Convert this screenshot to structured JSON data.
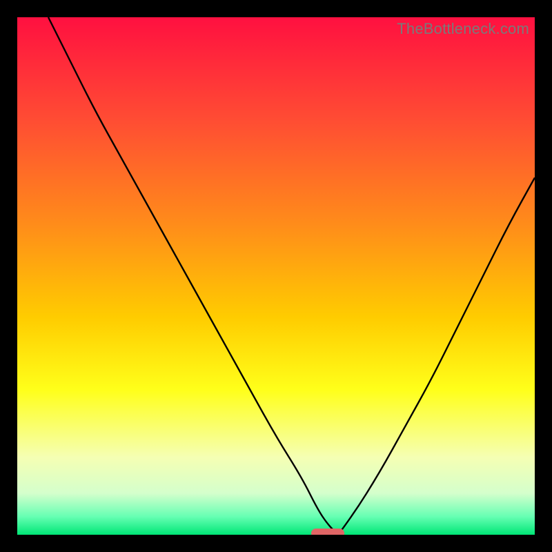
{
  "watermark": "TheBottleneck.com",
  "chart_data": {
    "type": "line",
    "title": "",
    "xlabel": "",
    "ylabel": "",
    "xlim": [
      0,
      100
    ],
    "ylim": [
      0,
      100
    ],
    "grid": false,
    "legend": false,
    "series": [
      {
        "name": "left-branch",
        "x": [
          6,
          10,
          15,
          20,
          25,
          30,
          35,
          40,
          45,
          50,
          55,
          58,
          60,
          62
        ],
        "y": [
          100,
          92,
          82,
          73,
          64,
          55,
          46,
          37,
          28,
          19,
          11,
          5,
          2,
          0
        ]
      },
      {
        "name": "right-branch",
        "x": [
          62,
          65,
          70,
          75,
          80,
          85,
          90,
          95,
          100
        ],
        "y": [
          0,
          4,
          12,
          21,
          30,
          40,
          50,
          60,
          69
        ]
      }
    ],
    "marker": {
      "name": "optimal-point",
      "x": 60,
      "y": 0,
      "color": "#e06666",
      "shape": "rounded-bar"
    },
    "background_gradient": {
      "stops": [
        {
          "offset": 0.0,
          "color": "#ff1040"
        },
        {
          "offset": 0.2,
          "color": "#ff4d33"
        },
        {
          "offset": 0.4,
          "color": "#ff8c1a"
        },
        {
          "offset": 0.58,
          "color": "#ffcc00"
        },
        {
          "offset": 0.72,
          "color": "#ffff1a"
        },
        {
          "offset": 0.85,
          "color": "#f5ffb3"
        },
        {
          "offset": 0.92,
          "color": "#d4ffcc"
        },
        {
          "offset": 0.965,
          "color": "#66ffb3"
        },
        {
          "offset": 1.0,
          "color": "#00e676"
        }
      ]
    }
  }
}
